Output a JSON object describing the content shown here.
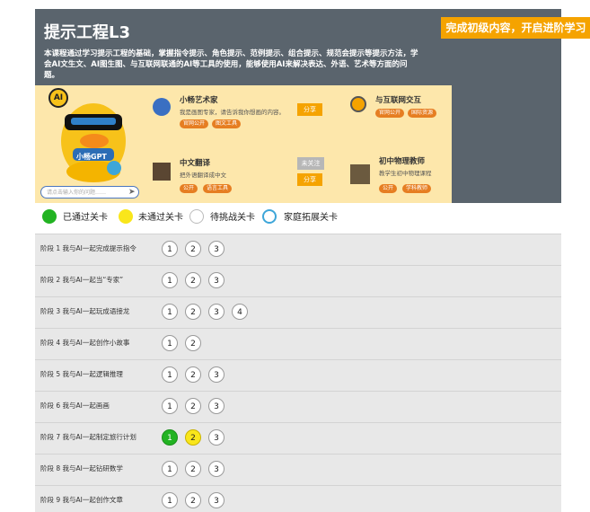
{
  "title": "提示工程L3",
  "promo_label": "完成初级内容，开启进阶学习",
  "description": "本课程通过学习提示工程的基础，掌握指令提示、角色提示、范例提示、组合提示、规范会提示等提示方法，学会AI文生文、AI图生图、与互联网联通的AI等工具的使用，能够使用AI来解决表达、外语、艺术等方面的问题。",
  "mascot": {
    "badge": "AI",
    "name_label": "小畅GPT",
    "input_placeholder": "请点击输入你的问题……"
  },
  "cards": [
    {
      "title": "小畅艺术家",
      "desc": "我是画图专家，请告诉我你想画的内容。",
      "tags": [
        "官网公开",
        "图文工具"
      ],
      "share": "分享"
    },
    {
      "title": "与互联网交互",
      "desc": "",
      "tags": [
        "官网公开",
        "国际资源"
      ],
      "share": ""
    },
    {
      "title": "中文翻译",
      "desc": "把外语翻译成中文",
      "tags": [
        "公开",
        "语言工具"
      ],
      "share": "分享",
      "follow": "未关注"
    },
    {
      "title": "初中物理教师",
      "desc": "教学生初中物理课程",
      "tags": [
        "公开",
        "学科教师"
      ],
      "share": ""
    }
  ],
  "legend": {
    "passed": "已通过关卡",
    "not_passed": "未通过关卡",
    "pending": "待挑战关卡",
    "family": "家庭拓展关卡"
  },
  "colors": {
    "passed": "#22b322",
    "not_passed": "#f9e61b",
    "pending": "#ffffff",
    "family_border": "#3ea6d9"
  },
  "stages": [
    {
      "label": "阶段 1 我与AI一起完成提示指令",
      "levels": [
        "1",
        "2",
        "3"
      ],
      "status": [
        "pending",
        "pending",
        "pending"
      ]
    },
    {
      "label": "阶段 2 我与AI一起当“专家”",
      "levels": [
        "1",
        "2",
        "3"
      ],
      "status": [
        "pending",
        "pending",
        "pending"
      ]
    },
    {
      "label": "阶段 3 我与AI一起玩成语接龙",
      "levels": [
        "1",
        "2",
        "3",
        "4"
      ],
      "status": [
        "pending",
        "pending",
        "pending",
        "pending"
      ]
    },
    {
      "label": "阶段 4 我与AI一起创作小故事",
      "levels": [
        "1",
        "2"
      ],
      "status": [
        "pending",
        "pending"
      ]
    },
    {
      "label": "阶段 5 我与AI一起逻辑推理",
      "levels": [
        "1",
        "2",
        "3"
      ],
      "status": [
        "pending",
        "pending",
        "pending"
      ]
    },
    {
      "label": "阶段 6 我与AI一起画画",
      "levels": [
        "1",
        "2",
        "3"
      ],
      "status": [
        "pending",
        "pending",
        "pending"
      ]
    },
    {
      "label": "阶段 7 我与AI一起制定旅行计划",
      "levels": [
        "1",
        "2",
        "3"
      ],
      "status": [
        "passed",
        "not_passed",
        "pending"
      ]
    },
    {
      "label": "阶段 8 我与AI一起钻研数学",
      "levels": [
        "1",
        "2",
        "3"
      ],
      "status": [
        "pending",
        "pending",
        "pending"
      ]
    },
    {
      "label": "阶段 9 我与AI一起创作文章",
      "levels": [
        "1",
        "2",
        "3"
      ],
      "status": [
        "pending",
        "pending",
        "pending"
      ]
    }
  ]
}
